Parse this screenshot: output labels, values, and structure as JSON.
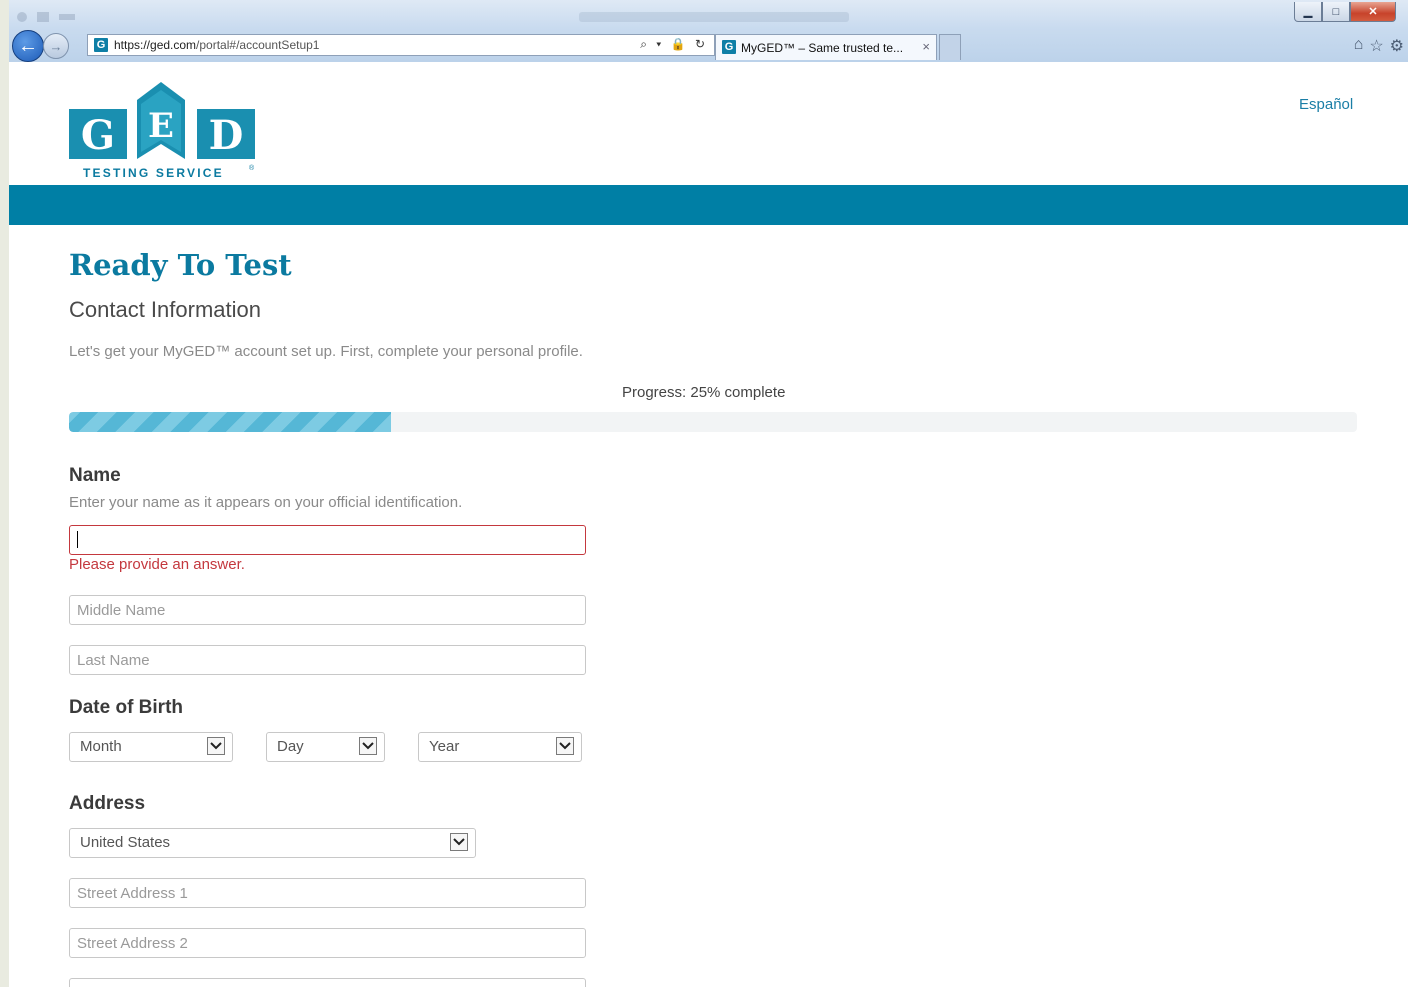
{
  "browser": {
    "url_domain": "https://ged.com",
    "url_path": "/portal#/accountSetup1",
    "tab_title": "MyGED™ – Same trusted te...",
    "tab_close": "×",
    "favicon": "G",
    "window_buttons": {
      "minimize": "▁",
      "maximize": "□",
      "close": "✕"
    },
    "nav": {
      "back": "←",
      "forward": "→"
    },
    "address_icons": "⌕ ▾ 🔒 ↻",
    "toolbar_icons": {
      "home": "⌂",
      "favorites": "☆",
      "tools": "⚙"
    }
  },
  "header": {
    "logo": {
      "letters": [
        "G",
        "E",
        "D"
      ],
      "tagline": "TESTING SERVICE",
      "mark": "®"
    },
    "language_link": "Español",
    "brand_color": "#007fa5"
  },
  "main": {
    "title": "Ready To Test",
    "subtitle": "Contact Information",
    "intro": "Let's get your MyGED™ account set up. First, complete your personal profile.",
    "progress": {
      "label": "Progress: 25% complete",
      "fraction": 0.25
    }
  },
  "name_section": {
    "heading": "Name",
    "hint": "Enter your name as it appears on your official identification.",
    "first_name": {
      "value": "",
      "error": "Please provide an answer."
    },
    "middle_name": {
      "placeholder": "Middle Name"
    },
    "last_name": {
      "placeholder": "Last Name"
    }
  },
  "dob_section": {
    "heading": "Date of Birth",
    "month": "Month",
    "day": "Day",
    "year": "Year"
  },
  "address_section": {
    "heading": "Address",
    "country": "United States",
    "street1": {
      "placeholder": "Street Address 1"
    },
    "street2": {
      "placeholder": "Street Address 2"
    },
    "street3": {
      "placeholder": ""
    }
  }
}
